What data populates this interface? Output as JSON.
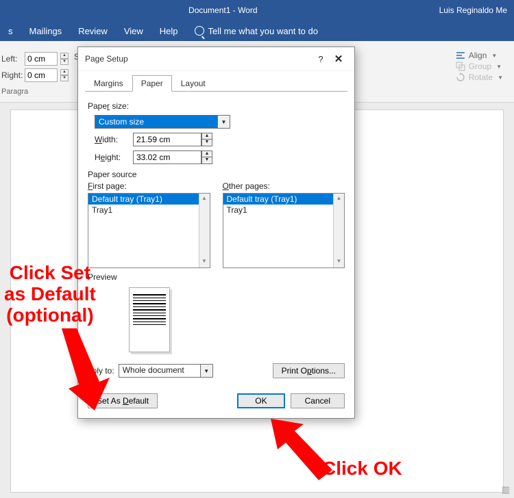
{
  "titlebar": {
    "center": "Document1 - Word",
    "right": "Luis Reginaldo Me"
  },
  "ribbon": {
    "tabs": [
      "s",
      "Mailings",
      "Review",
      "View",
      "Help"
    ],
    "tellme": "Tell me what you want to do",
    "indent": {
      "left_label": "Left:",
      "left_value": "0 cm",
      "right_label": "Right:",
      "right_value": "0 cm"
    },
    "paragraph_label": "Paragra",
    "spacing_label": "S",
    "arrange": {
      "align": "Align",
      "group": "Group",
      "rotate": "Rotate"
    }
  },
  "dialog": {
    "title": "Page Setup",
    "help": "?",
    "close": "✕",
    "tabs": {
      "margins": "Margins",
      "paper": "Paper",
      "layout": "Layout"
    },
    "paper_size_label": "Paper size:",
    "paper_size_value": "Custom size",
    "width_label": "Width:",
    "width_value": "21.59 cm",
    "height_label": "Height:",
    "height_value": "33.02 cm",
    "paper_source_label": "Paper source",
    "first_page_label": "First page:",
    "other_pages_label": "Other pages:",
    "tray_options": [
      "Default tray (Tray1)",
      "Tray1"
    ],
    "preview_label": "Preview",
    "apply_to_label": "pply to:",
    "apply_to_value": "Whole document",
    "print_options": "Print Options...",
    "set_default": "Set As Default",
    "ok": "OK",
    "cancel": "Cancel"
  },
  "annotations": {
    "set_default": "Click Set\nas Default\n(optional)",
    "ok": "Click OK"
  }
}
